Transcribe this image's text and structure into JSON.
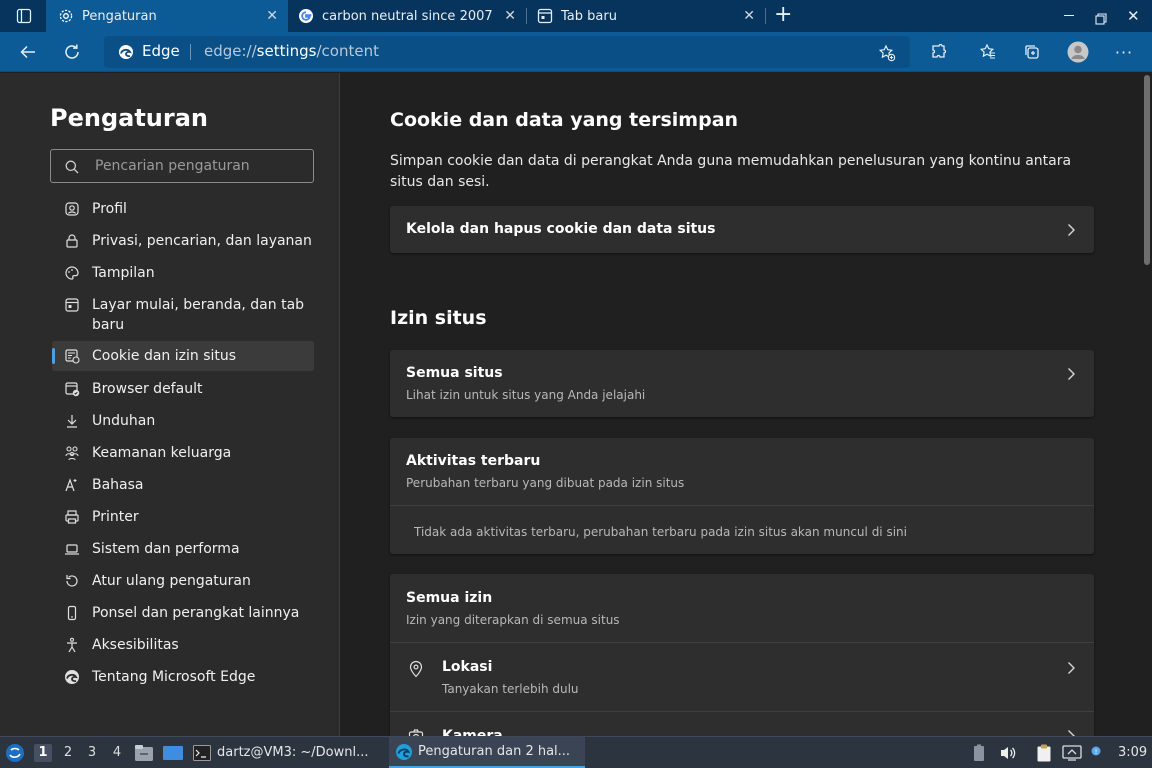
{
  "browser": {
    "tabs": [
      {
        "title": "Pengaturan",
        "icon": "gear-icon",
        "active": true
      },
      {
        "title": "carbon neutral since 2007",
        "icon": "google-icon",
        "active": false
      },
      {
        "title": "Tab baru",
        "icon": "newtab-icon",
        "active": false
      }
    ],
    "new_tab": "+",
    "address": {
      "brand": "Edge",
      "url_prefix": "edge://",
      "url_bold": "settings",
      "url_suffix": "/content"
    }
  },
  "sidebar": {
    "title": "Pengaturan",
    "search_placeholder": "Pencarian pengaturan",
    "items": [
      {
        "label": "Profil",
        "icon": "profile-icon"
      },
      {
        "label": "Privasi, pencarian, dan layanan",
        "icon": "lock-icon"
      },
      {
        "label": "Tampilan",
        "icon": "palette-icon"
      },
      {
        "label": "Layar mulai, beranda, dan tab baru",
        "icon": "home-tab-icon"
      },
      {
        "label": "Cookie dan izin situs",
        "icon": "cookie-icon",
        "active": true
      },
      {
        "label": "Browser default",
        "icon": "browser-default-icon"
      },
      {
        "label": "Unduhan",
        "icon": "download-icon"
      },
      {
        "label": "Keamanan keluarga",
        "icon": "family-icon"
      },
      {
        "label": "Bahasa",
        "icon": "language-icon"
      },
      {
        "label": "Printer",
        "icon": "printer-icon"
      },
      {
        "label": "Sistem dan performa",
        "icon": "laptop-icon"
      },
      {
        "label": "Atur ulang pengaturan",
        "icon": "reset-icon"
      },
      {
        "label": "Ponsel dan perangkat lainnya",
        "icon": "phone-icon"
      },
      {
        "label": "Aksesibilitas",
        "icon": "accessibility-icon"
      },
      {
        "label": "Tentang Microsoft Edge",
        "icon": "edge-icon"
      }
    ]
  },
  "main": {
    "cookies": {
      "heading": "Cookie dan data yang tersimpan",
      "description": "Simpan cookie dan data di perangkat Anda guna memudahkan penelusuran yang kontinu antara situs dan sesi.",
      "manage_label": "Kelola dan hapus cookie dan data situs"
    },
    "site_perms": {
      "heading": "Izin situs",
      "all_sites_title": "Semua situs",
      "all_sites_sub": "Lihat izin untuk situs yang Anda jelajahi",
      "recent_title": "Aktivitas terbaru",
      "recent_sub": "Perubahan terbaru yang dibuat pada izin situs",
      "recent_empty": "Tidak ada aktivitas terbaru, perubahan terbaru pada izin situs akan muncul di sini",
      "all_perms_title": "Semua izin",
      "all_perms_sub": "Izin yang diterapkan di semua situs",
      "location_title": "Lokasi",
      "location_sub": "Tanyakan terlebih dulu",
      "camera_title": "Kamera"
    }
  },
  "taskbar": {
    "workspaces": [
      "1",
      "2",
      "3",
      "4"
    ],
    "terminal_label": "dartz@VM3: ~/Downl...",
    "edge_label": "Pengaturan dan 2 hal...",
    "clock": "3:09"
  }
}
